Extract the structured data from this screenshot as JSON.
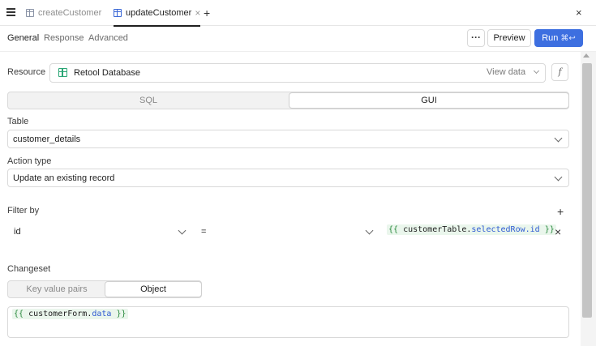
{
  "tabbar": {
    "tabs": [
      {
        "label": "createCustomer",
        "active": false
      },
      {
        "label": "updateCustomer",
        "active": true
      }
    ],
    "close_tab_glyph": "×",
    "add_tab_glyph": "+",
    "close_panel_glyph": "×"
  },
  "subnav": {
    "tabs": [
      {
        "label": "General",
        "active": true
      },
      {
        "label": "Response",
        "active": false
      },
      {
        "label": "Advanced",
        "active": false
      }
    ],
    "more_glyph": "···",
    "preview_label": "Preview",
    "run_label": "Run",
    "run_shortcut": "⌘↩"
  },
  "resource": {
    "label": "Resource",
    "name": "Retool Database",
    "view_data_label": "View data",
    "fx_label": "f"
  },
  "mode": {
    "options": [
      "SQL",
      "GUI"
    ],
    "selected": "GUI"
  },
  "table": {
    "label": "Table",
    "value": "customer_details"
  },
  "action_type": {
    "label": "Action type",
    "value": "Update an existing record"
  },
  "filter": {
    "label": "Filter by",
    "add_glyph": "+",
    "column": "id",
    "operator": "=",
    "value": {
      "open": "{{",
      "object": "customerTable",
      "dot": ".",
      "property": "selectedRow.id",
      "close": "}}"
    },
    "remove_glyph": "×"
  },
  "changeset": {
    "label": "Changeset",
    "options": [
      "Key value pairs",
      "Object"
    ],
    "selected": "Object",
    "value": {
      "open": "{{",
      "object": "customerForm",
      "dot": ".",
      "property": "data",
      "close": "}}"
    }
  },
  "colors": {
    "accent": "#3d6fe0",
    "database_icon": "#2aa675",
    "code_brace": "#2a8a3e",
    "code_property": "#2f5bd3"
  }
}
